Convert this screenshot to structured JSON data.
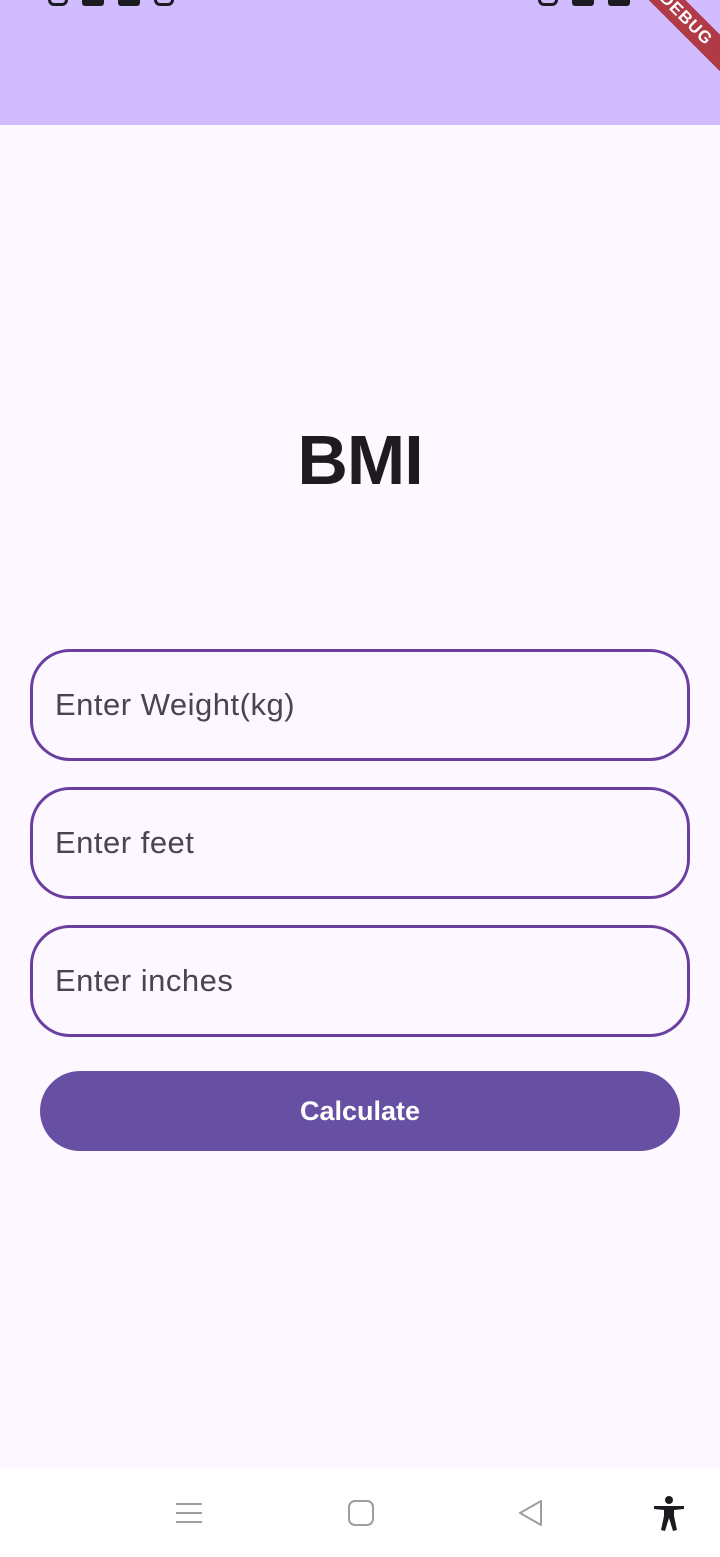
{
  "app": {
    "title": "BMI",
    "debug_banner": "DEBUG"
  },
  "form": {
    "weight_placeholder": "Enter Weight(kg)",
    "feet_placeholder": "Enter feet",
    "inches_placeholder": "Enter inches",
    "calculate_label": "Calculate"
  },
  "nav": {
    "icons": [
      "menu-icon",
      "home-icon",
      "back-icon",
      "accessibility-icon"
    ]
  },
  "colors": {
    "app_bar": "#d1bcff",
    "background": "#fdf7ff",
    "field_border": "#6a3fa0",
    "button": "#6750a4",
    "debug_ribbon": "#b13a47"
  }
}
